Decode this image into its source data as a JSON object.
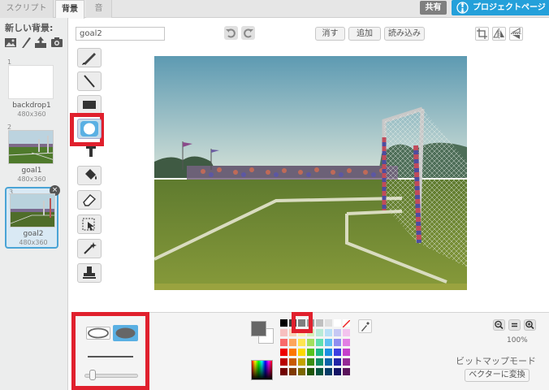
{
  "tabs": [
    "スクリプト",
    "背景",
    "音"
  ],
  "header": {
    "share_label": "共有",
    "project_label": "プロジェクトページ"
  },
  "sidebar": {
    "new_backdrop_label": "新しい背景:",
    "icons": [
      "paint-icon",
      "brush-icon",
      "upload-icon",
      "camera-icon"
    ],
    "backdrops": [
      {
        "num": "1",
        "name": "backdrop1",
        "size": "480x360"
      },
      {
        "num": "2",
        "name": "goal1",
        "size": "480x360"
      },
      {
        "num": "3",
        "name": "goal2",
        "size": "480x360"
      }
    ]
  },
  "editor": {
    "name_value": "goal2",
    "clear_label": "消す",
    "add_label": "追加",
    "import_label": "読み込み",
    "zoom_percent": "100%",
    "mode_label": "ビットマップモード",
    "convert_label": "ベクターに変換"
  },
  "tools": [
    "brush",
    "line",
    "rectangle",
    "ellipse",
    "text",
    "fill",
    "eraser",
    "select",
    "magic-select",
    "stamp"
  ],
  "colors": {
    "highlight": "#e0202d",
    "accent": "#24a0da",
    "primary_color": "#666666",
    "palette": [
      [
        "#000000",
        "#3f3f3f",
        "#7f7f7f",
        "#9f9f9f",
        "#bfbfbf",
        "#dfdfdf",
        "#ffffff",
        "#ffffff"
      ],
      [
        "#f7c0c0",
        "#f9d3b8",
        "#fbf0b6",
        "#d6f0b8",
        "#b7ead7",
        "#b8dff7",
        "#c6c8f4",
        "#f3c3ee"
      ],
      [
        "#f86b6b",
        "#fda65c",
        "#fde552",
        "#a3e05f",
        "#5fdfb0",
        "#5fbff3",
        "#8f8ef0",
        "#e27ee3"
      ],
      [
        "#ee0000",
        "#fc7700",
        "#fcd800",
        "#56c21f",
        "#1bb88c",
        "#1c8fe3",
        "#3d3fe1",
        "#c63fcb"
      ],
      [
        "#b80000",
        "#c75a00",
        "#c3a300",
        "#3a8e14",
        "#0e8b67",
        "#0c63a8",
        "#2325a6",
        "#952996"
      ],
      [
        "#700000",
        "#7e3800",
        "#7a6600",
        "#1f5609",
        "#06543f",
        "#063b66",
        "#121364",
        "#5a135b"
      ]
    ]
  }
}
